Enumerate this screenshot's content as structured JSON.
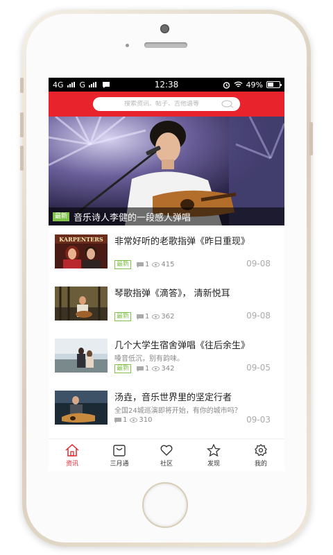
{
  "status_bar": {
    "network_left": "4G",
    "network_right": "G",
    "time": "12:38",
    "battery_percent": "49%",
    "battery_level": 0.49
  },
  "search": {
    "placeholder": "搜索资讯、帖子、吉他谱等"
  },
  "banner": {
    "tag": "最新",
    "title": "音乐诗人李健的一段感人弹唱"
  },
  "news": [
    {
      "title": "非常好听的老歌指弹《昨日重现》",
      "subtitle": "",
      "tag": "最新",
      "comments": "1",
      "views": "415",
      "date": "09-08",
      "thumb_text": "KARPENTERS"
    },
    {
      "title": "琴歌指弹《滴答》， 清新悦耳",
      "subtitle": "",
      "tag": "最新",
      "comments": "1",
      "views": "362",
      "date": "09-08"
    },
    {
      "title": "几个大学生宿舍弹唱《往后余生》",
      "subtitle": "嗓音低沉，别有韵味。",
      "tag": "最新",
      "comments": "1",
      "views": "342",
      "date": "09-05"
    },
    {
      "title": "汤垚，音乐世界里的坚定行者",
      "subtitle": "全国24城巡演即将开始，有你的城市吗？",
      "tag": "",
      "comments": "1",
      "views": "310",
      "date": "09-03"
    }
  ],
  "tabs": [
    {
      "label": "资讯",
      "icon": "home-icon",
      "active": true
    },
    {
      "label": "三月通",
      "icon": "bag-icon",
      "active": false
    },
    {
      "label": "社区",
      "icon": "heart-icon",
      "active": false
    },
    {
      "label": "发现",
      "icon": "star-icon",
      "active": false
    },
    {
      "label": "我的",
      "icon": "settings-icon",
      "active": false
    }
  ],
  "colors": {
    "accent": "#e8232c",
    "tag_green": "#7fc34a"
  }
}
